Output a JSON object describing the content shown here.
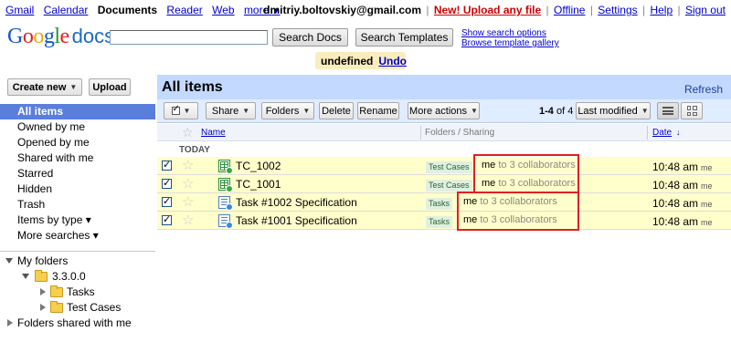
{
  "topnav": {
    "links": [
      "Gmail",
      "Calendar",
      "Documents",
      "Reader",
      "Web",
      "more"
    ],
    "current": "Documents",
    "more_caret": "▼"
  },
  "account": {
    "email": "dmitriy.boltovskiy@gmail.com",
    "new_upload": "New! Upload any file",
    "links": [
      "Offline",
      "Settings",
      "Help",
      "Sign out"
    ]
  },
  "logo": {
    "google": "Google",
    "docs": "docs"
  },
  "search": {
    "value": "",
    "search_docs_label": "Search Docs",
    "search_templates_label": "Search Templates",
    "show_options": "Show search options",
    "browse_gallery": "Browse template gallery"
  },
  "undo_msg": {
    "text": "undefined",
    "undo": "Undo"
  },
  "sidebar": {
    "create_new": "Create new",
    "upload": "Upload",
    "nav": [
      {
        "label": "All items",
        "selected": true
      },
      {
        "label": "Owned by me"
      },
      {
        "label": "Opened by me"
      },
      {
        "label": "Shared with me"
      },
      {
        "label": "Starred"
      },
      {
        "label": "Hidden"
      },
      {
        "label": "Trash"
      },
      {
        "label": "Items by type ▾"
      },
      {
        "label": "More searches ▾"
      }
    ],
    "folders": {
      "my_folders": "My folders",
      "root": "3.3.0.0",
      "children": [
        "Tasks",
        "Test Cases"
      ],
      "shared": "Folders shared with me"
    }
  },
  "main": {
    "title": "All items",
    "refresh": "Refresh",
    "toolbar": {
      "share": "Share",
      "folders": "Folders",
      "delete": "Delete",
      "rename": "Rename",
      "more_actions": "More actions",
      "range_bold": "1-4",
      "range_rest": "of 4",
      "sort": "Last modified"
    },
    "columns": {
      "name": "Name",
      "folders_sharing": "Folders / Sharing",
      "date": "Date",
      "date_arrow": "↓"
    },
    "section": "TODAY",
    "rows": [
      {
        "title": "TC_1002",
        "type": "spreadsheet",
        "folder": "Test Cases",
        "sharing_me": "me",
        "sharing_rest": "to 3 collaborators",
        "time": "10:48 am",
        "by": "me",
        "checked": true
      },
      {
        "title": "TC_1001",
        "type": "spreadsheet",
        "folder": "Test Cases",
        "sharing_me": "me",
        "sharing_rest": "to 3 collaborators",
        "time": "10:48 am",
        "by": "me",
        "checked": true
      },
      {
        "title": "Task #1002 Specification",
        "type": "document",
        "folder": "Tasks",
        "sharing_me": "me",
        "sharing_rest": "to 3 collaborators",
        "time": "10:48 am",
        "by": "me",
        "checked": true
      },
      {
        "title": "Task #1001 Specification",
        "type": "document",
        "folder": "Tasks",
        "sharing_me": "me",
        "sharing_rest": "to 3 collaborators",
        "time": "10:48 am",
        "by": "me",
        "checked": true
      }
    ]
  },
  "colors": {
    "selected_nav": "#5a7edc",
    "header_blue": "#c3d9ff",
    "row_highlight": "#ffffcc",
    "annotation_red": "#e02020",
    "link_blue": "#0000cc"
  }
}
